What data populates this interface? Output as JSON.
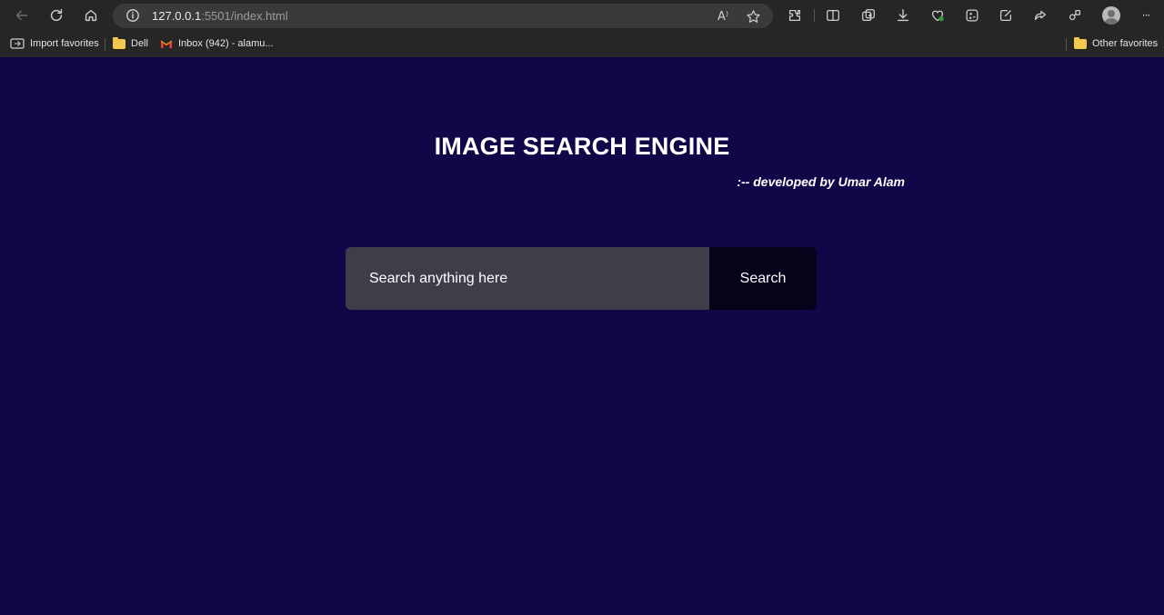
{
  "browser": {
    "address": {
      "host": "127.0.0.1",
      "path": ":5501/index.html"
    },
    "bookmarks": [
      {
        "label": "Import favorites"
      },
      {
        "label": "Dell"
      },
      {
        "label": "Inbox (942) - alamu..."
      }
    ],
    "other_favorites": "Other favorites",
    "read_aloud_glyph": "A⁾",
    "more_glyph": "···"
  },
  "page": {
    "title": "IMAGE SEARCH ENGINE",
    "subtitle": ":-- developed by Umar Alam",
    "search": {
      "placeholder": "Search anything here",
      "value": "",
      "button_label": "Search"
    },
    "colors": {
      "background": "#100749",
      "input_bg": "#3e3e4a",
      "button_bg": "#05021a",
      "text": "#ffffff"
    }
  }
}
